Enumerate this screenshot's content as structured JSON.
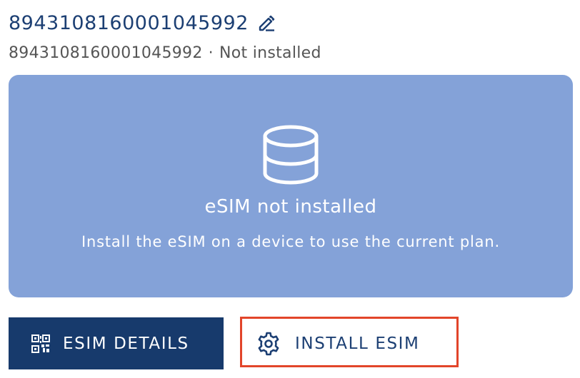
{
  "header": {
    "title": "8943108160001045992",
    "subtitle_id": "8943108160001045992",
    "subtitle_separator": "·",
    "status": "Not installed"
  },
  "panel": {
    "icon": "database-icon",
    "title": "eSIM not installed",
    "description": "Install the eSIM on a device to use the current plan."
  },
  "actions": {
    "details_label": "ESIM DETAILS",
    "details_icon": "qr-code-icon",
    "install_label": "INSTALL ESIM",
    "install_icon": "gear-icon"
  },
  "colors": {
    "title": "#1c3f73",
    "panel_bg": "#84a2d8",
    "primary_button": "#173a6c",
    "highlight": "#e2452a"
  }
}
